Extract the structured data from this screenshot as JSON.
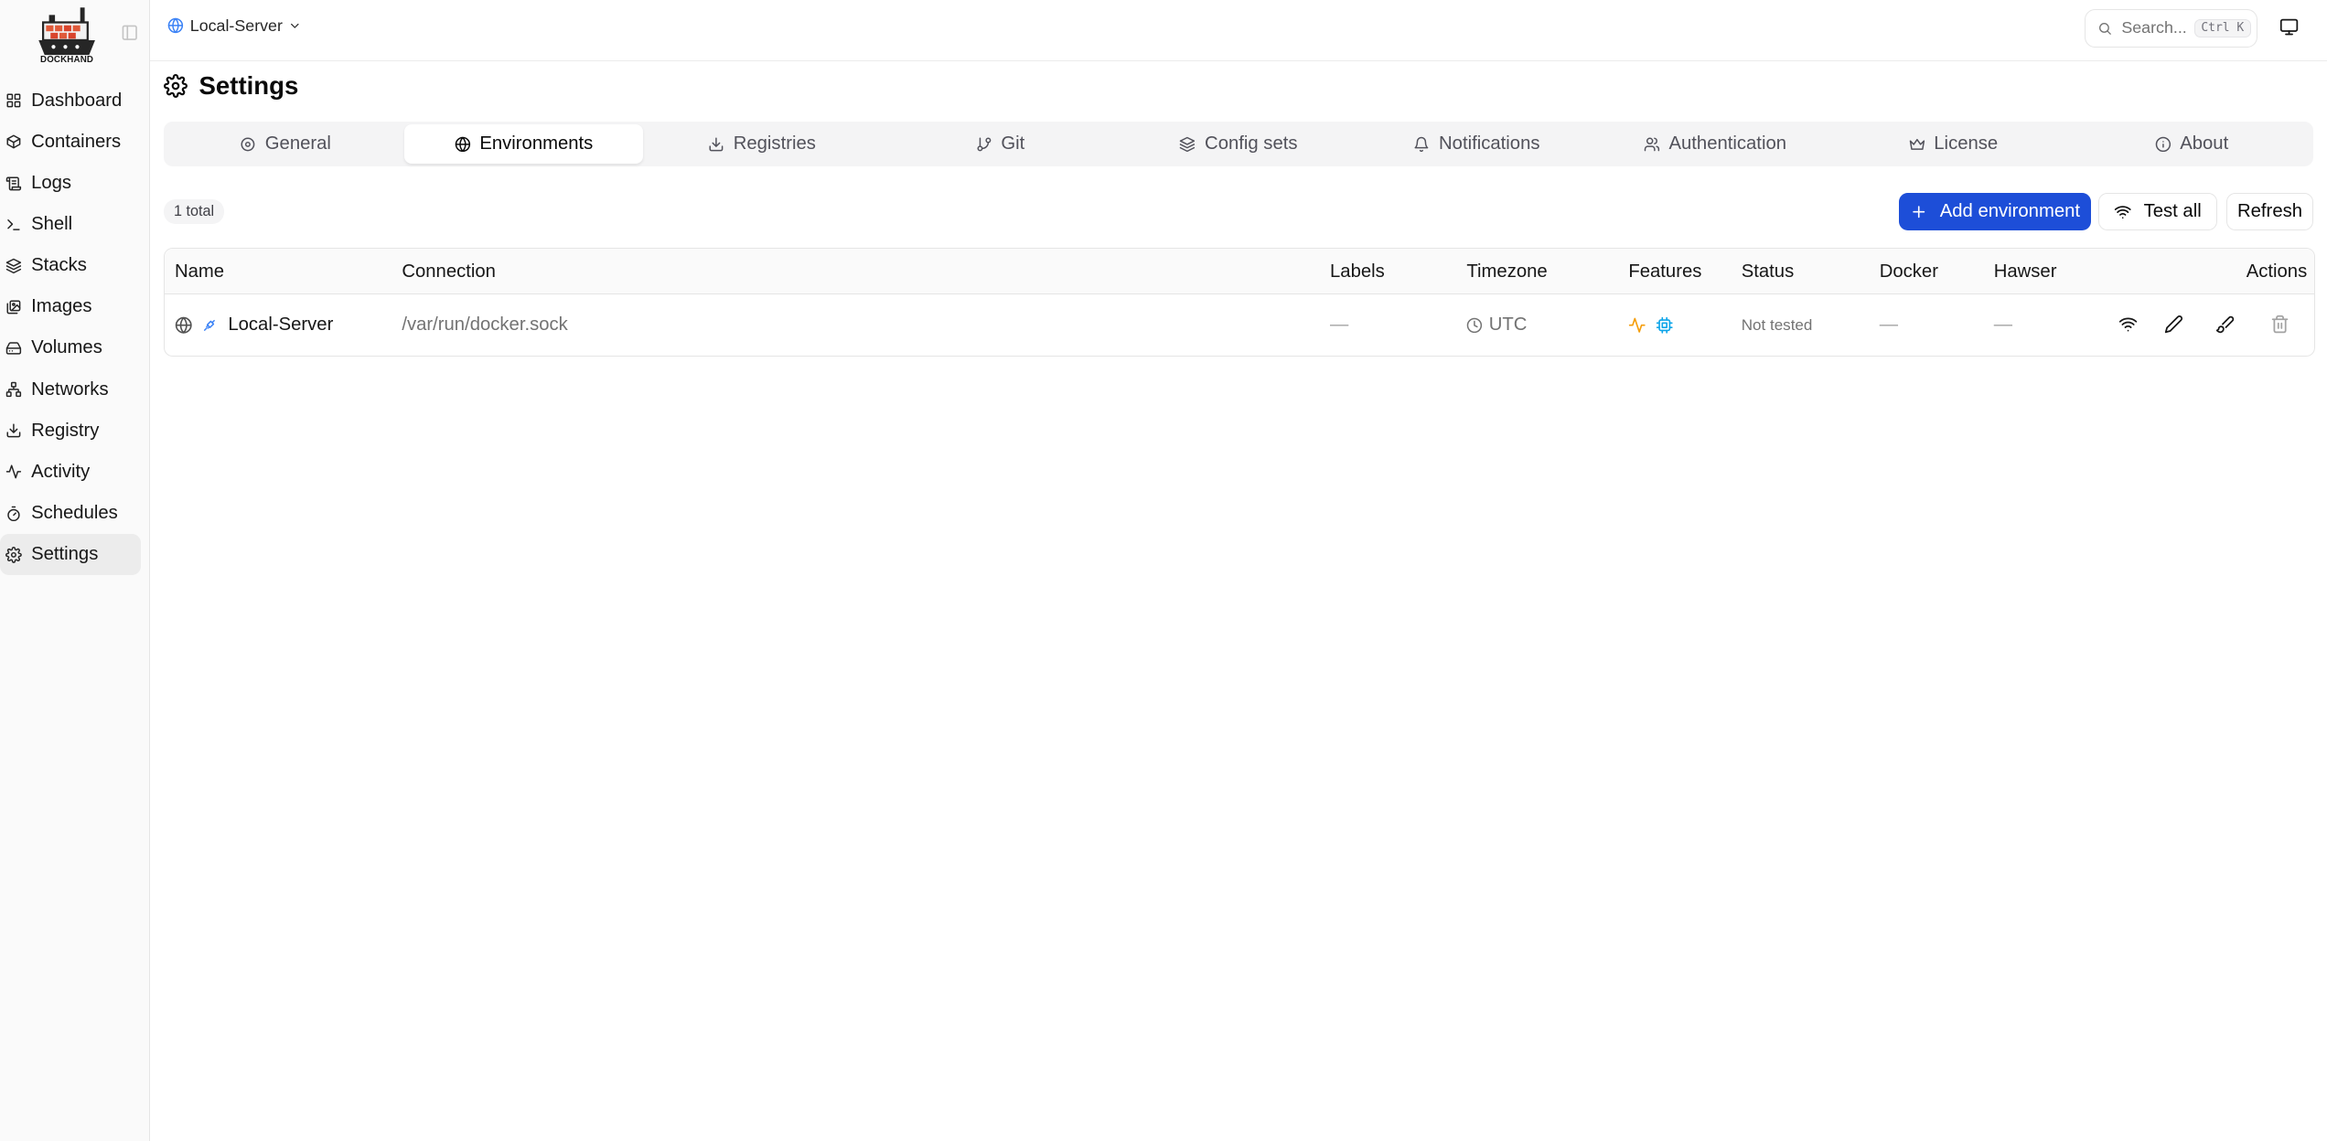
{
  "app": {
    "logo_text": "DOCKHAND"
  },
  "sidebar": {
    "items": [
      {
        "label": "Dashboard",
        "icon": "dashboard-icon"
      },
      {
        "label": "Containers",
        "icon": "box-icon"
      },
      {
        "label": "Logs",
        "icon": "scroll-icon"
      },
      {
        "label": "Shell",
        "icon": "terminal-icon"
      },
      {
        "label": "Stacks",
        "icon": "layers-icon"
      },
      {
        "label": "Images",
        "icon": "images-icon"
      },
      {
        "label": "Volumes",
        "icon": "hard-drive-icon"
      },
      {
        "label": "Networks",
        "icon": "network-icon"
      },
      {
        "label": "Registry",
        "icon": "download-icon"
      },
      {
        "label": "Activity",
        "icon": "activity-icon"
      },
      {
        "label": "Schedules",
        "icon": "timer-icon"
      },
      {
        "label": "Settings",
        "icon": "gear-icon",
        "active": true
      }
    ]
  },
  "header": {
    "environment": "Local-Server",
    "search_placeholder": "Search...",
    "search_shortcut": "Ctrl K"
  },
  "page": {
    "title": "Settings"
  },
  "tabs": [
    {
      "label": "General",
      "icon": "gear-icon"
    },
    {
      "label": "Environments",
      "icon": "globe-icon",
      "active": true
    },
    {
      "label": "Registries",
      "icon": "download-icon"
    },
    {
      "label": "Git",
      "icon": "git-branch-icon"
    },
    {
      "label": "Config sets",
      "icon": "layers-icon"
    },
    {
      "label": "Notifications",
      "icon": "bell-icon"
    },
    {
      "label": "Authentication",
      "icon": "users-icon"
    },
    {
      "label": "License",
      "icon": "crown-icon"
    },
    {
      "label": "About",
      "icon": "info-icon"
    }
  ],
  "toolbar": {
    "total": "1 total",
    "add_label": "Add environment",
    "test_all_label": "Test all",
    "refresh_label": "Refresh"
  },
  "table": {
    "columns": [
      "Name",
      "Connection",
      "Labels",
      "Timezone",
      "Features",
      "Status",
      "Docker",
      "Hawser",
      "Actions"
    ],
    "rows": [
      {
        "name": "Local-Server",
        "connection": "/var/run/docker.sock",
        "labels": "—",
        "timezone": "UTC",
        "features": [
          "activity-icon",
          "cpu-icon"
        ],
        "status": "Not tested",
        "docker": "—",
        "hawser": "—"
      }
    ]
  },
  "colors": {
    "primary": "#1d4ed8",
    "feature_activity": "#f59e0b",
    "feature_cpu": "#0ea5e9",
    "env_icon": "#3b82f6"
  }
}
